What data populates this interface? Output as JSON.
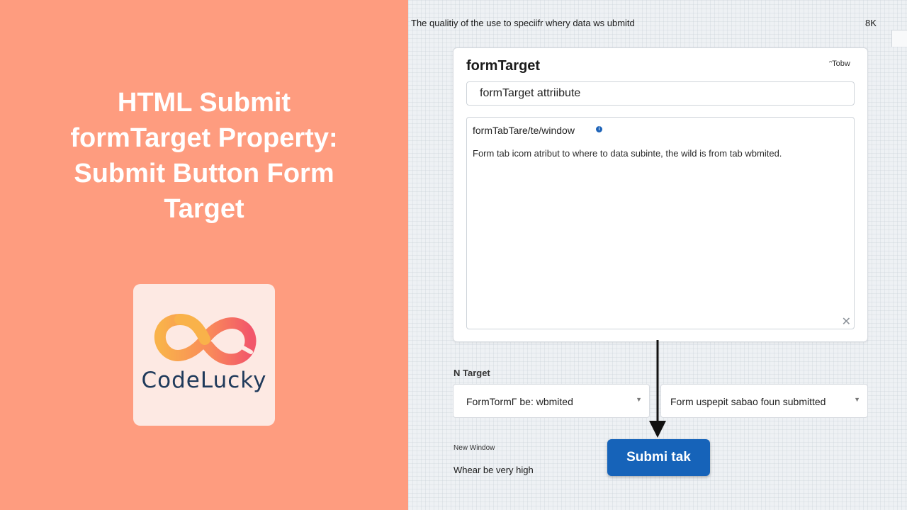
{
  "hero": {
    "title_line1": "HTML Submit",
    "title_line2": "formTarget Property:",
    "title_line3": "Submit Button Form",
    "title_line4": "Target"
  },
  "logo": {
    "text": "CodeLucky",
    "icon": "infinity-logo-icon"
  },
  "colors": {
    "left_bg": "#fe9c7f",
    "logo_card_bg": "#fde9e3",
    "logo_text": "#1f3a5b",
    "button_bg": "#1663b9",
    "info_icon": "#1d63b8"
  },
  "topbar": {
    "caption": "The qualitiy of the use to speciifr whery data ws ubmitd",
    "size": "8K"
  },
  "card": {
    "title": "formTarget",
    "tab_label": "ᵔTobw",
    "input_value": "formTarget attriibute",
    "textarea_label": "formTabTare/te/window",
    "textarea_body": "Form tab icom atribut to where to data subinte, the wild is from tab wbmited.",
    "info_icon": "info-icon",
    "close_icon": "close-icon"
  },
  "target": {
    "label": "N Target",
    "select1": "FormTormΓ be: wbmited",
    "select2": "Form uspepit sabao foun submitted"
  },
  "footer": {
    "new_window": "New Window",
    "high": "Whear be very high",
    "submit_label": "Submi tak"
  }
}
